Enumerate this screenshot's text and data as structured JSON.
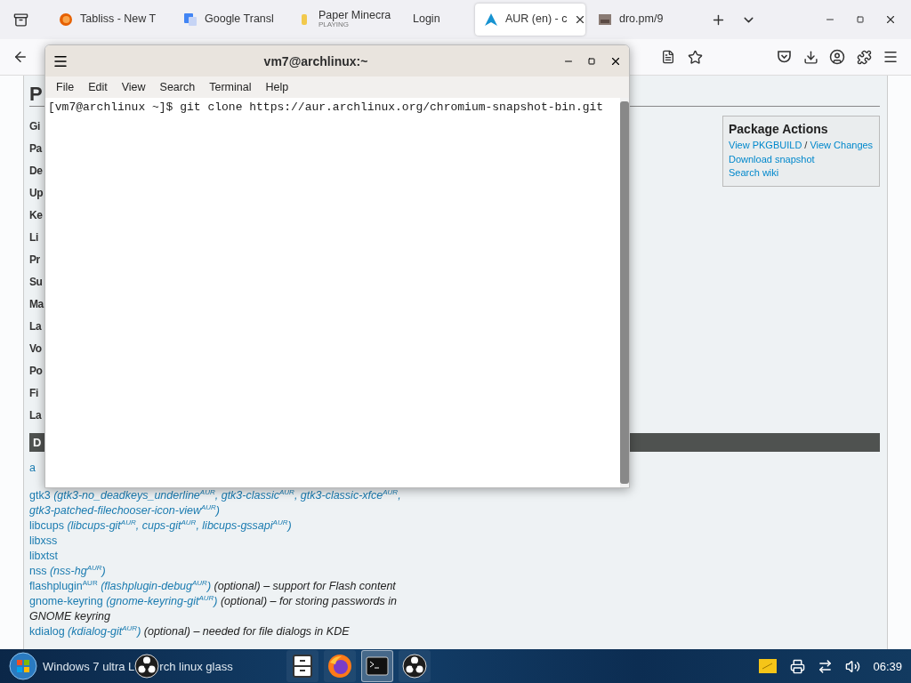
{
  "browser": {
    "tabs": [
      {
        "kind": "firefox",
        "label": "Tabliss - New T",
        "selected": false
      },
      {
        "kind": "translate",
        "label": "Google Transl",
        "selected": false
      },
      {
        "kind": "game",
        "label": "Paper Minecra",
        "status": "PLAYING",
        "selected": false
      },
      {
        "kind": "none",
        "label": "Login",
        "selected": false
      },
      {
        "kind": "arch",
        "label": "AUR (en) - c",
        "selected": true
      },
      {
        "kind": "image",
        "label": "dro.pm/9",
        "selected": false
      }
    ]
  },
  "page": {
    "heading": "P",
    "fields": [
      "Gi",
      "Pa",
      "De",
      "Up",
      "Ke",
      "Li",
      "Pr",
      "Su",
      "Ma",
      "La",
      "Vo",
      "Po",
      "Fi",
      "La"
    ],
    "package_actions": {
      "title": "Package Actions",
      "links": [
        [
          "View PKGBUILD",
          "View Changes"
        ],
        [
          "Download snapshot"
        ],
        [
          "Search wiki"
        ]
      ],
      "separator": "/"
    },
    "dependencies_header": "D",
    "dependencies": [
      {
        "name": "a"
      },
      {
        "name": "gtk3",
        "alternatives": [
          "(gtk3-no_deadkeys_underline$^{AUR}$,",
          "gtk3-classic$^{AUR}$,",
          "gtk3-classic-xfce$^{AUR}$,",
          "gtk3-patched-filechooser-icon-view$^{AUR}$)"
        ]
      },
      {
        "name": "libcups",
        "alternatives": [
          "(libcups-git$^{AUR}$,",
          "cups-git$^{AUR}$,",
          "libcups-gssapi$^{AUR}$)"
        ]
      },
      {
        "name": "libxss"
      },
      {
        "name": "libxtst"
      },
      {
        "name": "nss",
        "alternatives": [
          "(nss-hg$^{AUR}$)"
        ]
      },
      {
        "name": "flashplugin$^{AUR}$",
        "alternatives": [
          "(flashplugin-debug$^{AUR}$)"
        ],
        "note": "(optional) – support for Flash content"
      },
      {
        "name": "gnome-keyring",
        "alternatives": [
          "(gnome-keyring-git$^{AUR}$)"
        ],
        "note": "(optional) – for storing passwords in GNOME keyring"
      },
      {
        "name": "kdialog",
        "alternatives": [
          "(kdialog-git$^{AUR}$)"
        ],
        "note": "(optional) – needed for file dialogs in KDE"
      }
    ]
  },
  "terminal": {
    "title": "vm7@archlinux:~",
    "menu": [
      "File",
      "Edit",
      "View",
      "Search",
      "Terminal",
      "Help"
    ],
    "lines": [
      "[vm7@archlinux ~]$ git clone https://aur.archlinux.org/chromium-snapshot-bin.git"
    ]
  },
  "taskbar": {
    "task_left": "Windows 7 ultra L",
    "task_right": "rch linux glass",
    "apps": [
      {
        "kind": "files",
        "selected": false
      },
      {
        "kind": "firefox",
        "selected": false
      },
      {
        "kind": "terminal",
        "selected": true
      },
      {
        "kind": "obs",
        "selected": false
      }
    ],
    "clock": "06:39"
  }
}
